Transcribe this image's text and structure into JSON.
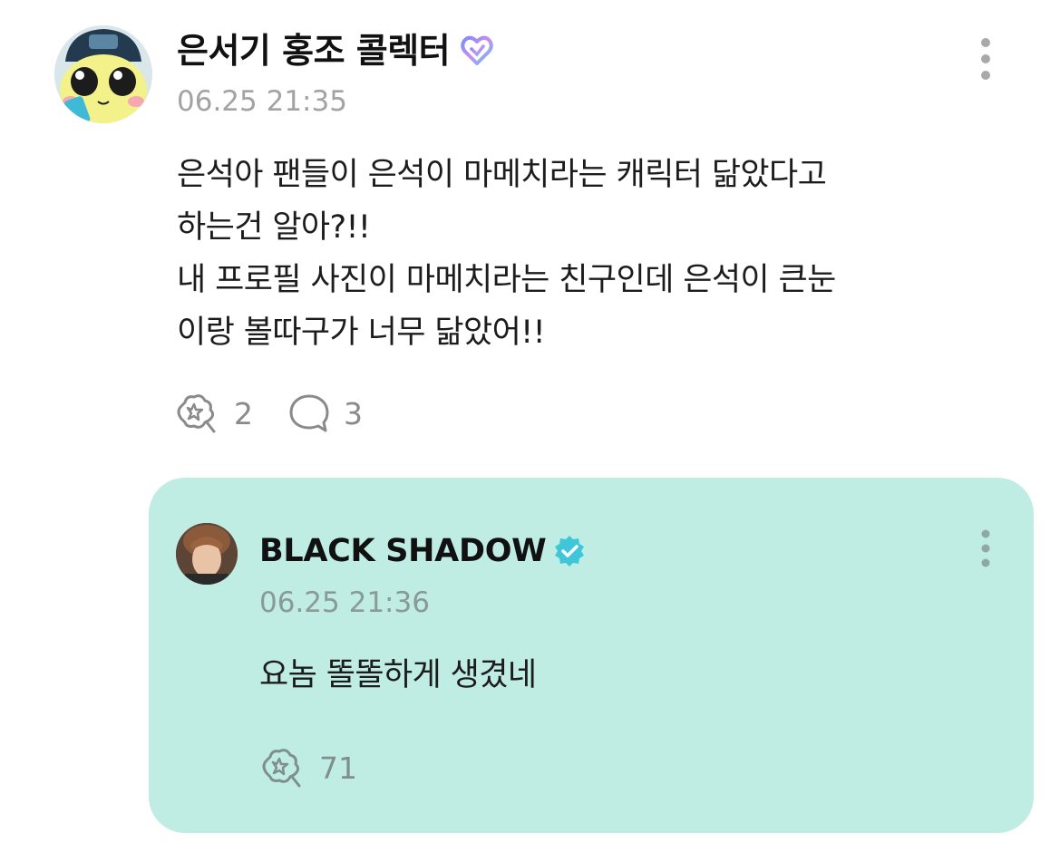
{
  "post": {
    "author": "은서기 홍조 콜렉터",
    "timestamp": "06.25 21:35",
    "body_lines": [
      "은석아 팬들이 은석이 마메치라는 캐릭터 닮았다고",
      "하는건 알아?!!",
      "내 프로필 사진이 마메치라는 친구인데 은석이 큰눈",
      "이랑 볼따구가 너무 닮았어!!"
    ],
    "reaction_count": "2",
    "comment_count": "3"
  },
  "reply": {
    "author": "BLACK SHADOW",
    "timestamp": "06.25 21:36",
    "body": "요놈 똘똘하게 생겼네",
    "reaction_count": "71"
  },
  "icons": {
    "author_badge": "gradient-heart-badge-icon",
    "reply_badge": "verified-check-badge-icon",
    "more": "more-vertical-icon",
    "reaction": "reaction-sticker-icon",
    "comment": "comment-bubble-icon"
  },
  "colors": {
    "reply_background": "#bfece3",
    "timestamp": "#a3a3a3",
    "verified_badge": "#3fc7d9",
    "author_badge_gradient": [
      "#7b8cff",
      "#c88cf0",
      "#5ec8f0"
    ]
  }
}
